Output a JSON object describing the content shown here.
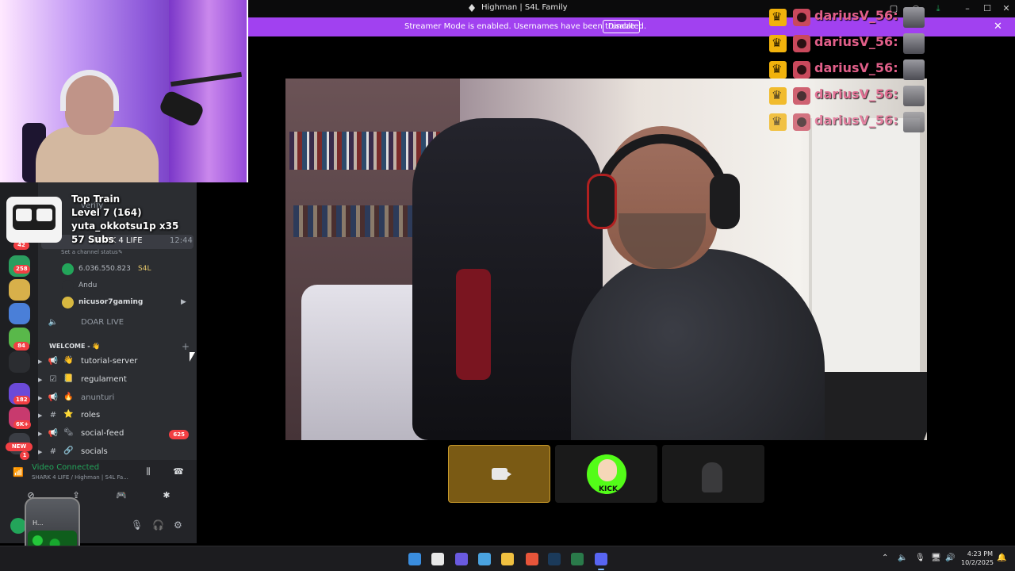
{
  "window": {
    "title": "Highman | S4L Family",
    "controls": [
      "minimize",
      "maximize",
      "close"
    ]
  },
  "banner": {
    "message": "Streamer Mode is enabled. Usernames have been truncated.",
    "disable_label": "Disable",
    "color": "#a141f0"
  },
  "overlay": {
    "train_title": "Top Train",
    "train_level": "Level 7  (164)",
    "train_user": "yuta_okkotsu1p x35",
    "train_subs": "57 Subs"
  },
  "guild_badges": [
    "42",
    "258",
    "84",
    "182",
    "6K+",
    "NEW",
    "1"
  ],
  "sidebar": {
    "verify_label": "verify",
    "voice_channel": {
      "name": "SHARK 4 LIFE",
      "time": "12:44",
      "status_hint": "Set a channel status"
    },
    "voice_users": [
      {
        "name": "6.036.550.823",
        "tag": "S4L"
      },
      {
        "name": "Andu"
      },
      {
        "name": "nicusor7gaming"
      }
    ],
    "doar_live": "DOAR LIVE",
    "section": "WELCOME - 👋",
    "channels": [
      {
        "name": "tutorial-server",
        "emoji": "👋",
        "type": "announce"
      },
      {
        "name": "regulament",
        "emoji": "📒",
        "type": "rules"
      },
      {
        "name": "anunturi",
        "emoji": "🔥",
        "type": "announce"
      },
      {
        "name": "roles",
        "emoji": "⭐",
        "type": "text"
      },
      {
        "name": "social-feed",
        "emoji": "🗞",
        "type": "announce",
        "badge": "625"
      },
      {
        "name": "socials",
        "emoji": "🔗",
        "type": "text"
      }
    ]
  },
  "voice_panel": {
    "status": "Video Connected",
    "location": "SHARK 4 LIFE / Highman | S4L Fa...",
    "user_short": "H..."
  },
  "stage": {
    "tiles": [
      {
        "name": "camera",
        "selected": true
      },
      {
        "name": "kick",
        "label": "KICK"
      },
      {
        "name": "participant"
      }
    ]
  },
  "chat": {
    "username": "dariusV_56:",
    "lines": 5,
    "name_color": "#e15f89"
  },
  "taskbar": {
    "time": "4:23 PM",
    "date": "10/2/2025"
  }
}
